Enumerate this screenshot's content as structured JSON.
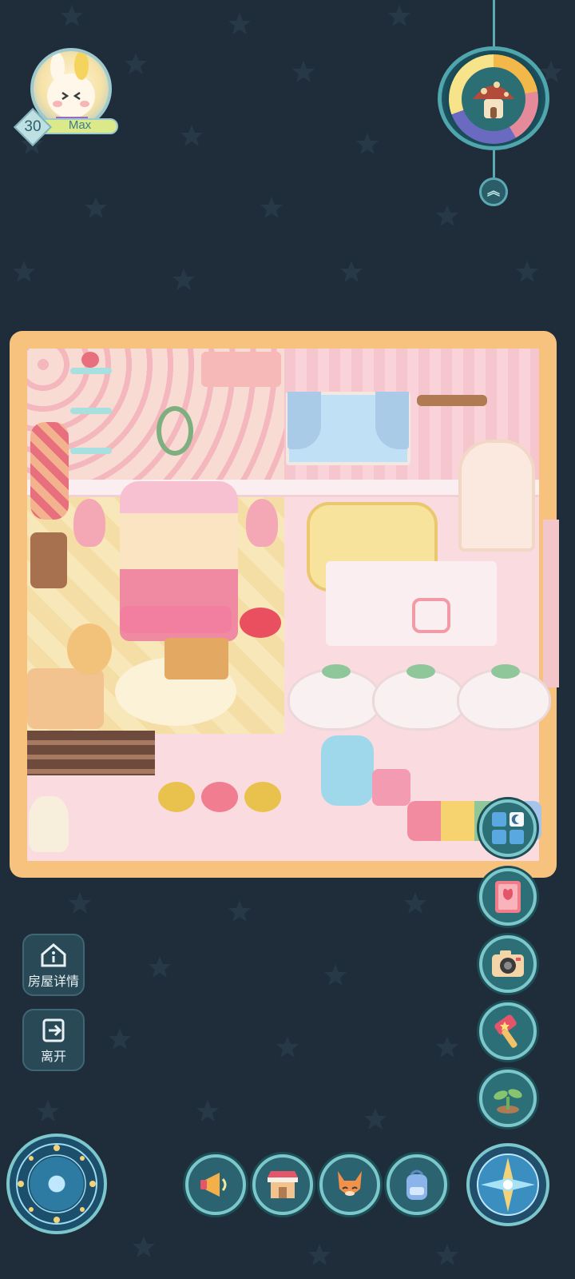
{
  "player": {
    "level": "30",
    "name": "Max"
  },
  "side_buttons": {
    "house_details": "房屋详情",
    "leave": "离开"
  },
  "icons": {
    "house": "house-info-icon",
    "exit": "exit-icon",
    "expand": "chevron-double-up-icon",
    "furniture_panel": "furniture-panel-icon",
    "guestbook": "book-icon",
    "camera": "camera-icon",
    "hammer": "hammer-icon",
    "sprout": "sprout-icon",
    "megaphone": "megaphone-icon",
    "shop": "shop-icon",
    "pet": "fox-icon",
    "backpack": "backpack-icon",
    "magic_circle": "magic-circle-icon",
    "compass": "compass-icon",
    "weather_clock": "weather-clock-icon"
  },
  "colors": {
    "background": "#1f2d3a",
    "room_border": "#f7c27e",
    "accent": "#7cc7cc"
  }
}
